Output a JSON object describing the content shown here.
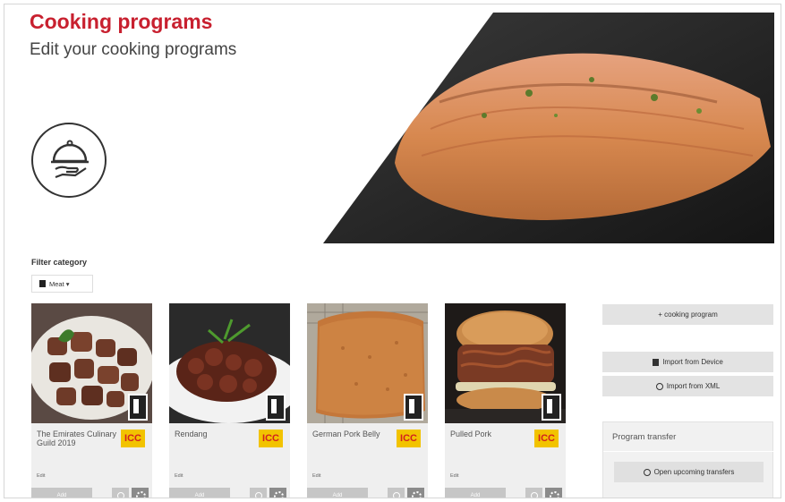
{
  "header": {
    "title": "Cooking programs",
    "subtitle": "Edit your cooking programs"
  },
  "icons": {
    "hero": "serving-cloche-icon",
    "filter": "filter-icon",
    "device": "combi-oven-icon",
    "info": "info-icon",
    "settings": "settings-icon"
  },
  "filter": {
    "label": "Filter category",
    "selected": "Meat ▾"
  },
  "cards": [
    {
      "name": "The Emirates Culinary Guild 2019",
      "badge": "ICC",
      "edit": "Edit",
      "add": "Add"
    },
    {
      "name": "Rendang",
      "badge": "ICC",
      "edit": "Edit",
      "add": "Add"
    },
    {
      "name": "German Pork Belly",
      "badge": "ICC",
      "edit": "Edit",
      "add": "Add"
    },
    {
      "name": "Pulled Pork",
      "badge": "ICC",
      "edit": "Edit",
      "add": "Add"
    }
  ],
  "sidebar": {
    "new_program": "+ cooking program",
    "import_device": "Import from Device",
    "import_xml": "Import from XML"
  },
  "transfer": {
    "title": "Program transfer",
    "button": "Open upcoming transfers"
  },
  "colors": {
    "brand_red": "#c8202f",
    "badge_yellow": "#f2c300",
    "button_grey": "#c6c6c6"
  }
}
